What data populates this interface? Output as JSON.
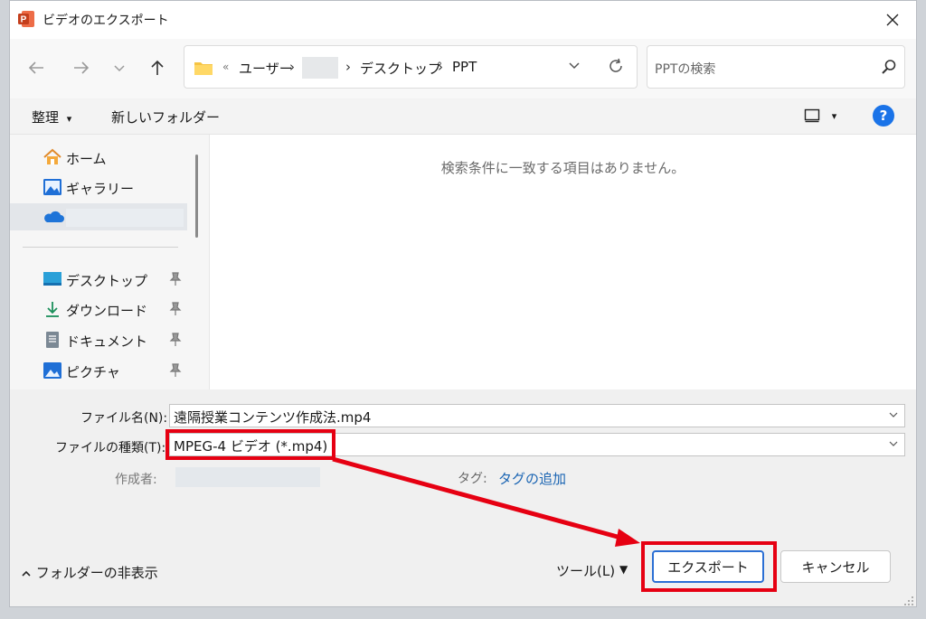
{
  "window": {
    "title": "ビデオのエクスポート"
  },
  "navigation": {
    "breadcrumb": {
      "overflow": "«",
      "items": [
        "ユーザー",
        "デスクトップ",
        "PPT"
      ]
    },
    "search_placeholder": "PPTの検索"
  },
  "toolbar": {
    "organize_label": "整理",
    "organize_arrow": "▾",
    "new_folder_label": "新しいフォルダー",
    "view_arrow": "▾",
    "help_label": "?"
  },
  "sidebar": {
    "items": [
      {
        "label": "ホーム",
        "icon": "home-icon",
        "pinned": false
      },
      {
        "label": "ギャラリー",
        "icon": "gallery-icon",
        "pinned": false
      },
      {
        "label": "",
        "icon": "onedrive-icon",
        "pinned": false
      },
      {
        "label": "デスクトップ",
        "icon": "desktop-icon",
        "pinned": true
      },
      {
        "label": "ダウンロード",
        "icon": "download-icon",
        "pinned": true
      },
      {
        "label": "ドキュメント",
        "icon": "documents-icon",
        "pinned": true
      },
      {
        "label": "ピクチャ",
        "icon": "pictures-icon",
        "pinned": true
      }
    ]
  },
  "content": {
    "empty_message": "検索条件に一致する項目はありません。"
  },
  "form": {
    "filename_label": "ファイル名(N):",
    "filename_value": "遠隔授業コンテンツ作成法.mp4",
    "filetype_label": "ファイルの種類(T):",
    "filetype_value": "MPEG-4 ビデオ (*.mp4)",
    "author_label": "作成者:",
    "tag_label": "タグ:",
    "tag_link": "タグの追加"
  },
  "footer": {
    "hide_folders_label": "フォルダーの非表示",
    "tools_label": "ツール(L)",
    "tools_arrow": "▼",
    "export_button": "エクスポート",
    "cancel_button": "キャンセル"
  },
  "colors": {
    "highlight_red": "#e60012",
    "accent_blue": "#1a73e8",
    "link_blue": "#1b65b3"
  }
}
